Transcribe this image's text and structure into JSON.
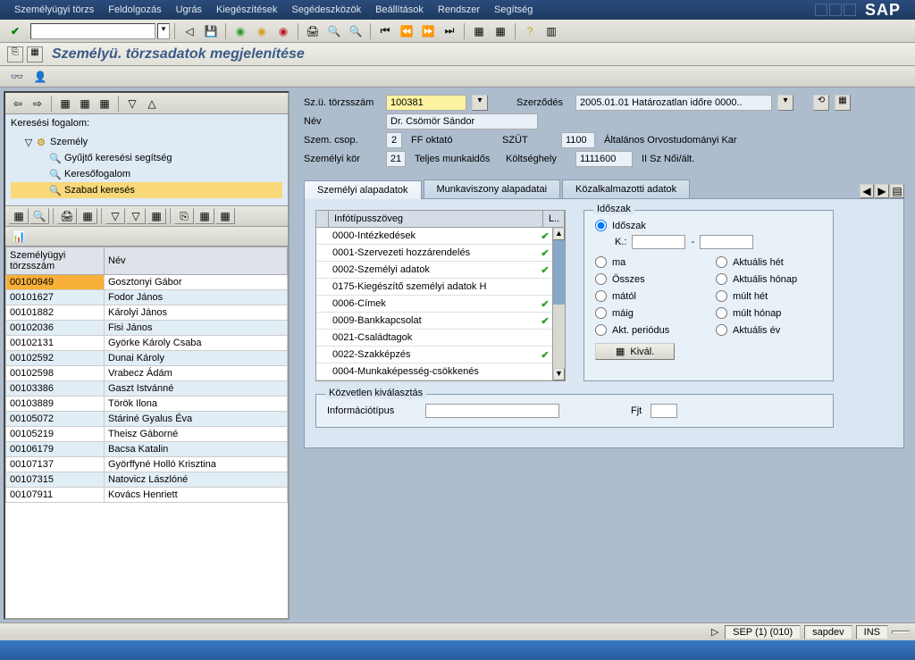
{
  "menubar": {
    "items": [
      {
        "label": "Személyügyi törzs",
        "u": "S"
      },
      {
        "label": "Feldolgozás",
        "u": "F"
      },
      {
        "label": "Ugrás",
        "u": "U"
      },
      {
        "label": "Kiegészítések",
        "u": "K"
      },
      {
        "label": "Segédeszközök",
        "u": "S"
      },
      {
        "label": "Beállítások",
        "u": "B"
      },
      {
        "label": "Rendszer",
        "u": "R"
      },
      {
        "label": "Segítség",
        "u": "S"
      }
    ]
  },
  "titlebar": {
    "title": "Személyü. törzsadatok megjelenítése"
  },
  "left": {
    "search_label": "Keresési fogalom:",
    "tree": {
      "root": "Személy",
      "children": [
        {
          "label": "Gyűjtő keresési segítség"
        },
        {
          "label": "Keresőfogalom"
        },
        {
          "label": "Szabad keresés",
          "selected": true
        }
      ]
    },
    "table": {
      "cols": [
        "Személyügyi törzsszám",
        "Név"
      ],
      "rows": [
        [
          "00100949",
          "Gosztonyi Gábor"
        ],
        [
          "00101627",
          "Fodor János"
        ],
        [
          "00101882",
          "Károlyi János"
        ],
        [
          "00102036",
          "Fisi János"
        ],
        [
          "00102131",
          "Györke Károly Csaba"
        ],
        [
          "00102592",
          "Dunai Károly"
        ],
        [
          "00102598",
          "Vrabecz Ádám"
        ],
        [
          "00103386",
          "Gaszt Istvánné"
        ],
        [
          "00103889",
          "Török Ilona"
        ],
        [
          "00105072",
          "Stáriné Gyalus Éva"
        ],
        [
          "00105219",
          "Theisz Gáborné"
        ],
        [
          "00106179",
          "Bacsa Katalin"
        ],
        [
          "00107137",
          "Györffyné Holló Krisztina"
        ],
        [
          "00107315",
          "Natovicz Lászlóné"
        ],
        [
          "00107911",
          "Kovács Henriett"
        ]
      ]
    }
  },
  "header": {
    "personnel_no_label": "Sz.ü. törzsszám",
    "personnel_no": "100381",
    "contract_label": "Szerződés",
    "contract": "2005.01.01 Határozatlan időre 0000..",
    "name_label": "Név",
    "name": "Dr. Csömör Sándor",
    "group_label": "Szem. csop.",
    "group_code": "2",
    "group_text": "FF oktató",
    "szut_label": "SZÜT",
    "szut_code": "1100",
    "szut_text": "Általános Orvostudományi Kar",
    "kor_label": "Személyi kör",
    "kor_code": "21",
    "kor_text": "Teljes munkaidős",
    "costcenter_label": "Költséghely",
    "costcenter": "1111600",
    "costcenter_text": "II Sz Női/ált."
  },
  "tabs": {
    "items": [
      "Személyi alapadatok",
      "Munkaviszony alapadatai",
      "Közalkalmazotti adatok"
    ],
    "active": 0
  },
  "infotypes": {
    "header": "Infótípusszöveg",
    "header_r": "L..",
    "rows": [
      {
        "label": "0000-Intézkedések",
        "ok": true
      },
      {
        "label": "0001-Szervezeti hozzárendelés",
        "ok": true
      },
      {
        "label": "0002-Személyi adatok",
        "ok": true
      },
      {
        "label": "0175-Kiegészítő személyi adatok H",
        "ok": false
      },
      {
        "label": "0006-Címek",
        "ok": true
      },
      {
        "label": "0009-Bankkapcsolat",
        "ok": true
      },
      {
        "label": "0021-Családtagok",
        "ok": false
      },
      {
        "label": "0022-Szakképzés",
        "ok": true
      },
      {
        "label": "0004-Munkaképesség-csökkenés",
        "ok": false
      }
    ]
  },
  "period": {
    "legend": "Időszak",
    "idoszak": "Időszak",
    "k_label": "K.:",
    "dash": "-",
    "options": [
      [
        "ma",
        "Aktuális hét"
      ],
      [
        "Összes",
        "Aktuális hónap"
      ],
      [
        "mától",
        "múlt hét"
      ],
      [
        "máig",
        "múlt hónap"
      ],
      [
        "Akt. periódus",
        "Aktuális év"
      ]
    ],
    "button": "Kivál."
  },
  "direct": {
    "legend": "Közvetlen kiválasztás",
    "info_label": "Információtípus",
    "fjt_label": "Fjt"
  },
  "statusbar": {
    "session": "SEP (1) (010)",
    "server": "sapdev",
    "mode": "INS"
  }
}
